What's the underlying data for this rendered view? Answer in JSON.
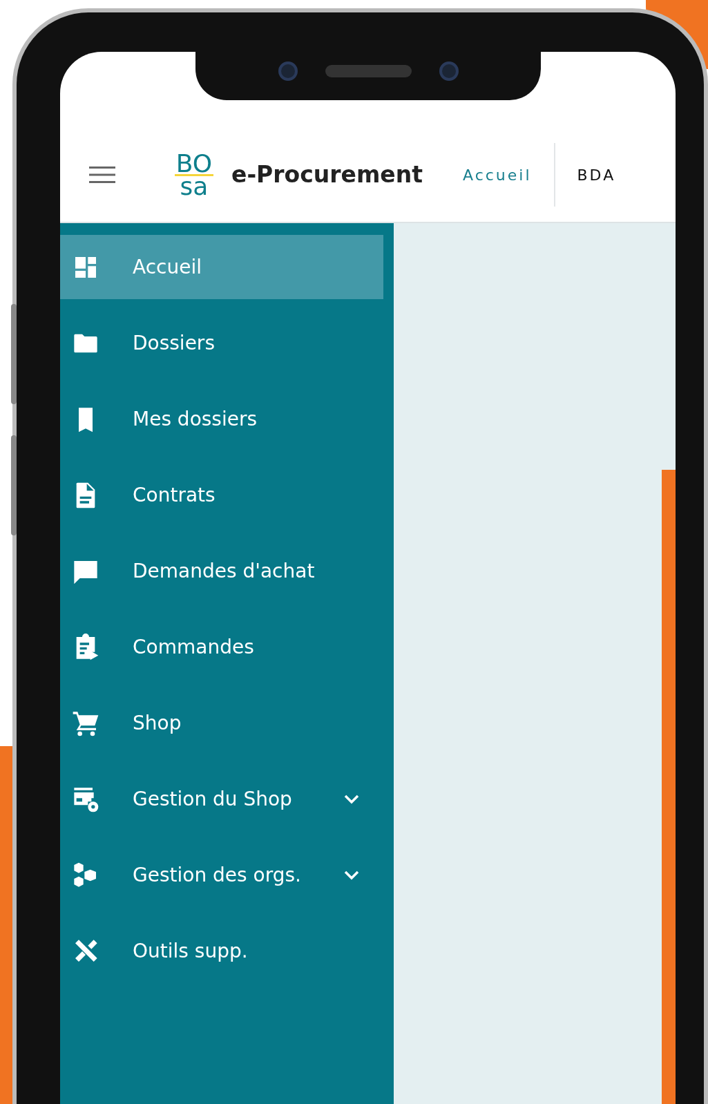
{
  "header": {
    "logo": [
      "BO",
      "sa"
    ],
    "app_name": "e-Procurement",
    "nav": [
      {
        "label": "Accueil",
        "selected": true
      },
      {
        "label": "BDA",
        "selected": false
      }
    ]
  },
  "sidebar": {
    "items": [
      {
        "label": "Accueil",
        "selected": true,
        "expandable": false
      },
      {
        "label": "Dossiers",
        "selected": false,
        "expandable": false
      },
      {
        "label": "Mes dossiers",
        "selected": false,
        "expandable": false
      },
      {
        "label": "Contrats",
        "selected": false,
        "expandable": false
      },
      {
        "label": "Demandes d'achat",
        "selected": false,
        "expandable": false
      },
      {
        "label": "Commandes",
        "selected": false,
        "expandable": false
      },
      {
        "label": "Shop",
        "selected": false,
        "expandable": false
      },
      {
        "label": "Gestion du Shop",
        "selected": false,
        "expandable": true
      },
      {
        "label": "Gestion des orgs.",
        "selected": false,
        "expandable": true
      },
      {
        "label": "Outils supp.",
        "selected": false,
        "expandable": false
      }
    ]
  }
}
